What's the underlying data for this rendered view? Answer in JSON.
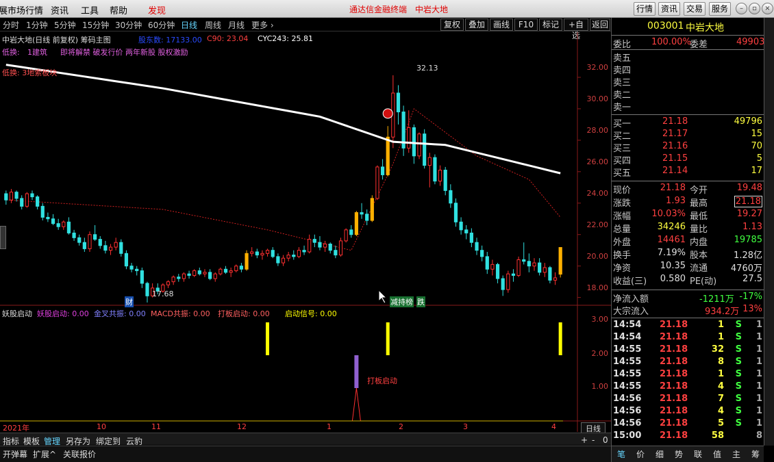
{
  "topbar": {
    "menus": [
      "展市场行情",
      "资讯",
      "工具",
      "帮助",
      "发现"
    ],
    "title": "通达信金融终端　中岩大地",
    "buttons": [
      "行情",
      "资讯",
      "交易",
      "服务"
    ]
  },
  "periods": [
    "分时",
    "1分钟",
    "5分钟",
    "15分钟",
    "30分钟",
    "60分钟",
    "日线",
    "周线",
    "月线",
    "更多 ›"
  ],
  "right_buttons": [
    "复权",
    "叠加",
    "画线",
    "F10",
    "标记",
    "+自选",
    "返回"
  ],
  "chart": {
    "header_name": "中岩大地(日线 前复权) 筹码主图",
    "header_fields": [
      {
        "label": "股东数: 17133.00",
        "color": "#2a4bff"
      },
      {
        "label": "C90: 23.04",
        "color": "#ff4040"
      },
      {
        "label": "CYC243: 25.81",
        "color": "#ffffff"
      }
    ],
    "line2_label": "低换:",
    "line2_value": "1建筑",
    "line2_tags": "即将解禁 破发行价 两年新股 股权激励",
    "line3": "低换: 3地索板块",
    "high_label": "32.13",
    "low_label": "17.68",
    "marker_cai": "财",
    "marker_hot": "减持榜",
    "marker_die": "跌",
    "price_ticks": [
      "32.00",
      "30.00",
      "28.00",
      "26.00",
      "24.00",
      "22.00",
      "20.00",
      "18.00"
    ],
    "sub_title": "妖股启动",
    "sub_fields": [
      {
        "label": "妖股启动: 0.00",
        "color": "#e040e0"
      },
      {
        "label": "金叉共振: 0.00",
        "color": "#8080ff"
      },
      {
        "label": "MACD共振: 0.00",
        "color": "#ff6060"
      },
      {
        "label": "打板启动: 0.00",
        "color": "#ff6060"
      },
      {
        "label": "启动信号: 0.00",
        "color": "#ffff00"
      }
    ],
    "sub_ticks": [
      "3.00",
      "2.00",
      "1.00"
    ],
    "sub_annotation": "打板启动",
    "date_labels": [
      "2021年",
      "10",
      "11",
      "12",
      "1",
      "2",
      "3",
      "4"
    ],
    "period_box": "日线"
  },
  "bottom_tabs": [
    "指标",
    "模板",
    "管理",
    "另存为",
    "绑定到",
    "云豹"
  ],
  "bottom_tabs2": [
    "开弹幕",
    "扩展^",
    "关联报价"
  ],
  "side": {
    "code": "003001",
    "name": "中岩大地",
    "wb_label": "委比",
    "wb_value": "100.00%",
    "wc_label": "委差",
    "wc_value": "49903",
    "sells": [
      "卖五",
      "卖四",
      "卖三",
      "卖二",
      "卖一"
    ],
    "buys": [
      {
        "label": "买一",
        "price": "21.18",
        "vol": "49796"
      },
      {
        "label": "买二",
        "price": "21.17",
        "vol": "15"
      },
      {
        "label": "买三",
        "price": "21.16",
        "vol": "70"
      },
      {
        "label": "买四",
        "price": "21.15",
        "vol": "5"
      },
      {
        "label": "买五",
        "price": "21.14",
        "vol": "17"
      }
    ],
    "stats": [
      {
        "l1": "现价",
        "v1": "21.18",
        "c1": "#ff4040",
        "l2": "今开",
        "v2": "19.48",
        "c2": "#ff4040"
      },
      {
        "l1": "涨跌",
        "v1": "1.93",
        "c1": "#ff4040",
        "l2": "最高",
        "v2": "21.18",
        "c2": "#ff4040"
      },
      {
        "l1": "涨幅",
        "v1": "10.03%",
        "c1": "#ff4040",
        "l2": "最低",
        "v2": "19.27",
        "c2": "#ff4040"
      },
      {
        "l1": "总量",
        "v1": "34246",
        "c1": "#ffff40",
        "l2": "量比",
        "v2": "1.13",
        "c2": "#ff4040"
      },
      {
        "l1": "外盘",
        "v1": "14461",
        "c1": "#ff4040",
        "l2": "内盘",
        "v2": "19785",
        "c2": "#40ff40"
      },
      {
        "l1": "换手",
        "v1": "7.19%",
        "c1": "#e0e0e0",
        "l2": "股本",
        "v2": "1.28亿",
        "c2": "#e0e0e0"
      },
      {
        "l1": "净资",
        "v1": "10.35",
        "c1": "#e0e0e0",
        "l2": "流通",
        "v2": "4760万",
        "c2": "#e0e0e0"
      },
      {
        "l1": "收益(三)",
        "v1": "0.580",
        "c1": "#e0e0e0",
        "l2": "PE(动)",
        "v2": "27.5",
        "c2": "#e0e0e0"
      }
    ],
    "flow": [
      {
        "label": "净流入额",
        "value": "-1211万",
        "pct": "-17%",
        "color": "#40ff40"
      },
      {
        "label": "大宗流入",
        "value": "934.2万",
        "pct": "13%",
        "color": "#ff4040"
      }
    ],
    "ticks": [
      {
        "t": "14:54",
        "p": "21.18",
        "v": "1",
        "s": "S",
        "n": "1"
      },
      {
        "t": "14:54",
        "p": "21.18",
        "v": "1",
        "s": "S",
        "n": "1"
      },
      {
        "t": "14:55",
        "p": "21.18",
        "v": "32",
        "s": "S",
        "n": "1"
      },
      {
        "t": "14:55",
        "p": "21.18",
        "v": "8",
        "s": "S",
        "n": "1"
      },
      {
        "t": "14:55",
        "p": "21.18",
        "v": "1",
        "s": "S",
        "n": "1"
      },
      {
        "t": "14:55",
        "p": "21.18",
        "v": "4",
        "s": "S",
        "n": "1"
      },
      {
        "t": "14:56",
        "p": "21.18",
        "v": "7",
        "s": "S",
        "n": "1"
      },
      {
        "t": "14:56",
        "p": "21.18",
        "v": "4",
        "s": "S",
        "n": "1"
      },
      {
        "t": "14:56",
        "p": "21.18",
        "v": "5",
        "s": "S",
        "n": "1"
      },
      {
        "t": "15:00",
        "p": "21.18",
        "v": "58",
        "s": "",
        "n": "8"
      }
    ],
    "tabs": [
      "笔",
      "价",
      "细",
      "势",
      "联",
      "值",
      "主",
      "筹"
    ]
  },
  "colors": {
    "up": "#ff3030",
    "down": "#30e0e0",
    "signal": "#ffff00",
    "ma": "#ffffff"
  },
  "chart_data": {
    "type": "candlestick",
    "ylim": [
      17.2,
      33.0
    ],
    "candles": [
      [
        24.6,
        24.8,
        23.9,
        24.2
      ],
      [
        24.2,
        24.9,
        24.0,
        24.7
      ],
      [
        24.7,
        24.8,
        24.1,
        24.3
      ],
      [
        24.3,
        24.5,
        23.6,
        23.8
      ],
      [
        23.8,
        24.7,
        23.7,
        24.6
      ],
      [
        24.6,
        24.8,
        24.2,
        24.4
      ],
      [
        24.4,
        24.5,
        23.6,
        23.8
      ],
      [
        23.8,
        24.0,
        22.9,
        23.1
      ],
      [
        23.1,
        23.4,
        22.8,
        23.0
      ],
      [
        23.0,
        23.3,
        22.6,
        22.7
      ],
      [
        22.7,
        23.0,
        22.3,
        22.5
      ],
      [
        22.5,
        22.9,
        22.3,
        22.8
      ],
      [
        22.8,
        23.1,
        22.0,
        22.1
      ],
      [
        22.1,
        22.3,
        21.6,
        21.8
      ],
      [
        21.8,
        22.0,
        21.3,
        21.5
      ],
      [
        21.5,
        21.8,
        20.9,
        21.1
      ],
      [
        21.1,
        22.2,
        20.9,
        22.0
      ],
      [
        22.0,
        22.6,
        21.6,
        21.7
      ],
      [
        21.7,
        21.9,
        21.1,
        21.3
      ],
      [
        21.3,
        21.6,
        20.8,
        21.0
      ],
      [
        21.0,
        21.4,
        20.7,
        21.2
      ],
      [
        21.2,
        21.8,
        21.0,
        21.5
      ],
      [
        21.5,
        21.7,
        20.6,
        20.8
      ],
      [
        20.8,
        21.0,
        19.8,
        20.0
      ],
      [
        20.0,
        20.2,
        19.6,
        19.8
      ],
      [
        19.8,
        20.0,
        19.4,
        19.7
      ],
      [
        19.7,
        19.9,
        18.6,
        18.9
      ],
      [
        18.9,
        19.0,
        17.68,
        18.1
      ],
      [
        18.1,
        18.9,
        18.0,
        18.6
      ],
      [
        18.6,
        18.9,
        18.2,
        18.4
      ],
      [
        18.4,
        18.9,
        18.3,
        18.8
      ],
      [
        18.8,
        19.1,
        18.6,
        19.0
      ],
      [
        19.0,
        19.4,
        18.8,
        19.3
      ],
      [
        19.3,
        19.5,
        19.0,
        19.2
      ],
      [
        19.2,
        19.6,
        19.0,
        19.5
      ],
      [
        19.5,
        19.7,
        19.2,
        19.4
      ],
      [
        19.4,
        19.8,
        19.3,
        19.7
      ],
      [
        19.7,
        19.9,
        19.4,
        19.5
      ],
      [
        19.5,
        19.8,
        19.3,
        19.6
      ],
      [
        19.6,
        19.8,
        19.1,
        19.2
      ],
      [
        19.2,
        19.6,
        19.0,
        19.5
      ],
      [
        19.5,
        19.9,
        19.4,
        19.8
      ],
      [
        19.8,
        20.0,
        19.5,
        19.6
      ],
      [
        19.6,
        19.9,
        19.3,
        19.7
      ],
      [
        19.7,
        20.1,
        19.6,
        20.0
      ],
      [
        20.0,
        20.2,
        19.6,
        19.8
      ],
      [
        19.8,
        21.0,
        19.7,
        20.8
      ],
      [
        20.8,
        21.2,
        20.6,
        20.9
      ],
      [
        20.9,
        21.1,
        20.5,
        20.7
      ],
      [
        20.7,
        21.0,
        20.4,
        20.8
      ],
      [
        20.8,
        21.1,
        20.6,
        21.0
      ],
      [
        21.0,
        21.2,
        20.5,
        20.6
      ],
      [
        20.6,
        20.8,
        20.0,
        20.2
      ],
      [
        20.2,
        20.7,
        20.0,
        20.5
      ],
      [
        20.5,
        20.9,
        20.3,
        20.7
      ],
      [
        20.7,
        21.0,
        20.4,
        20.6
      ],
      [
        20.6,
        21.2,
        20.5,
        21.0
      ],
      [
        21.0,
        21.3,
        20.7,
        20.9
      ],
      [
        20.9,
        22.0,
        20.8,
        21.7
      ],
      [
        21.7,
        22.0,
        21.2,
        21.5
      ],
      [
        21.5,
        21.9,
        21.0,
        21.2
      ],
      [
        21.2,
        21.6,
        20.9,
        21.4
      ],
      [
        21.4,
        21.5,
        20.8,
        21.0
      ],
      [
        21.0,
        21.3,
        20.5,
        20.7
      ],
      [
        20.7,
        21.8,
        20.6,
        21.6
      ],
      [
        21.6,
        22.4,
        21.5,
        22.3
      ],
      [
        22.3,
        22.6,
        21.8,
        22.0
      ],
      [
        22.0,
        23.5,
        21.9,
        23.4
      ],
      [
        23.4,
        24.0,
        23.0,
        23.3
      ],
      [
        23.3,
        23.6,
        22.6,
        22.9
      ],
      [
        22.9,
        24.5,
        22.8,
        24.3
      ],
      [
        24.3,
        26.4,
        24.2,
        26.3
      ],
      [
        26.3,
        26.8,
        25.5,
        25.8
      ],
      [
        25.8,
        28.9,
        25.7,
        28.2
      ],
      [
        28.2,
        32.13,
        27.5,
        31.0
      ],
      [
        31.0,
        31.5,
        29.0,
        29.8
      ],
      [
        29.8,
        30.2,
        27.0,
        27.5
      ],
      [
        27.5,
        29.9,
        27.2,
        28.8
      ],
      [
        28.8,
        29.0,
        26.5,
        27.0
      ],
      [
        27.0,
        28.5,
        26.8,
        28.4
      ],
      [
        28.4,
        28.7,
        26.2,
        26.4
      ],
      [
        26.4,
        27.2,
        25.0,
        26.9
      ],
      [
        26.9,
        27.1,
        25.2,
        25.4
      ],
      [
        25.4,
        26.4,
        25.1,
        26.1
      ],
      [
        26.1,
        26.3,
        24.5,
        24.8
      ],
      [
        24.8,
        25.2,
        23.7,
        24.0
      ],
      [
        24.0,
        24.3,
        22.5,
        22.8
      ],
      [
        22.8,
        23.1,
        22.0,
        22.3
      ],
      [
        22.3,
        22.6,
        21.7,
        22.1
      ],
      [
        22.1,
        22.4,
        21.2,
        21.5
      ],
      [
        21.5,
        21.8,
        20.7,
        21.0
      ],
      [
        21.0,
        21.3,
        20.3,
        20.6
      ],
      [
        20.6,
        20.9,
        19.5,
        19.8
      ],
      [
        19.8,
        20.4,
        19.4,
        20.1
      ],
      [
        20.1,
        20.2,
        18.9,
        19.2
      ],
      [
        19.2,
        19.4,
        18.1,
        18.5
      ],
      [
        18.5,
        19.7,
        18.3,
        19.5
      ],
      [
        19.5,
        19.8,
        19.0,
        19.4
      ],
      [
        19.4,
        20.6,
        19.3,
        20.4
      ],
      [
        20.4,
        21.5,
        20.1,
        20.3
      ],
      [
        20.3,
        20.8,
        19.6,
        20.0
      ],
      [
        20.0,
        20.5,
        19.7,
        20.2
      ],
      [
        20.2,
        20.5,
        19.4,
        19.6
      ],
      [
        19.6,
        20.2,
        19.3,
        19.9
      ],
      [
        19.9,
        20.0,
        18.9,
        19.1
      ],
      [
        19.1,
        19.6,
        18.8,
        19.25
      ],
      [
        19.48,
        21.18,
        19.27,
        21.18
      ]
    ],
    "limit_up_days": [
      46,
      67,
      70,
      73,
      106
    ],
    "ma_white": {
      "x": [
        0,
        30,
        60,
        74,
        84,
        106
      ],
      "y": [
        32.8,
        31.3,
        29.5,
        27.9,
        27.7,
        25.9
      ]
    },
    "cost_red": {
      "x": [
        0,
        30,
        50,
        66,
        74,
        78,
        90,
        100,
        106
      ],
      "y": [
        24.2,
        23.6,
        22.3,
        21.0,
        26.5,
        30.0,
        27.0,
        25.5,
        23.1
      ]
    },
    "signal_bars": [
      {
        "index": 73,
        "value": 3
      },
      {
        "index": 106,
        "value": 3
      },
      {
        "index": 0,
        "value": 3,
        "hidden": true
      }
    ],
    "dbqd_bar": {
      "index": 67,
      "value": 2
    }
  }
}
